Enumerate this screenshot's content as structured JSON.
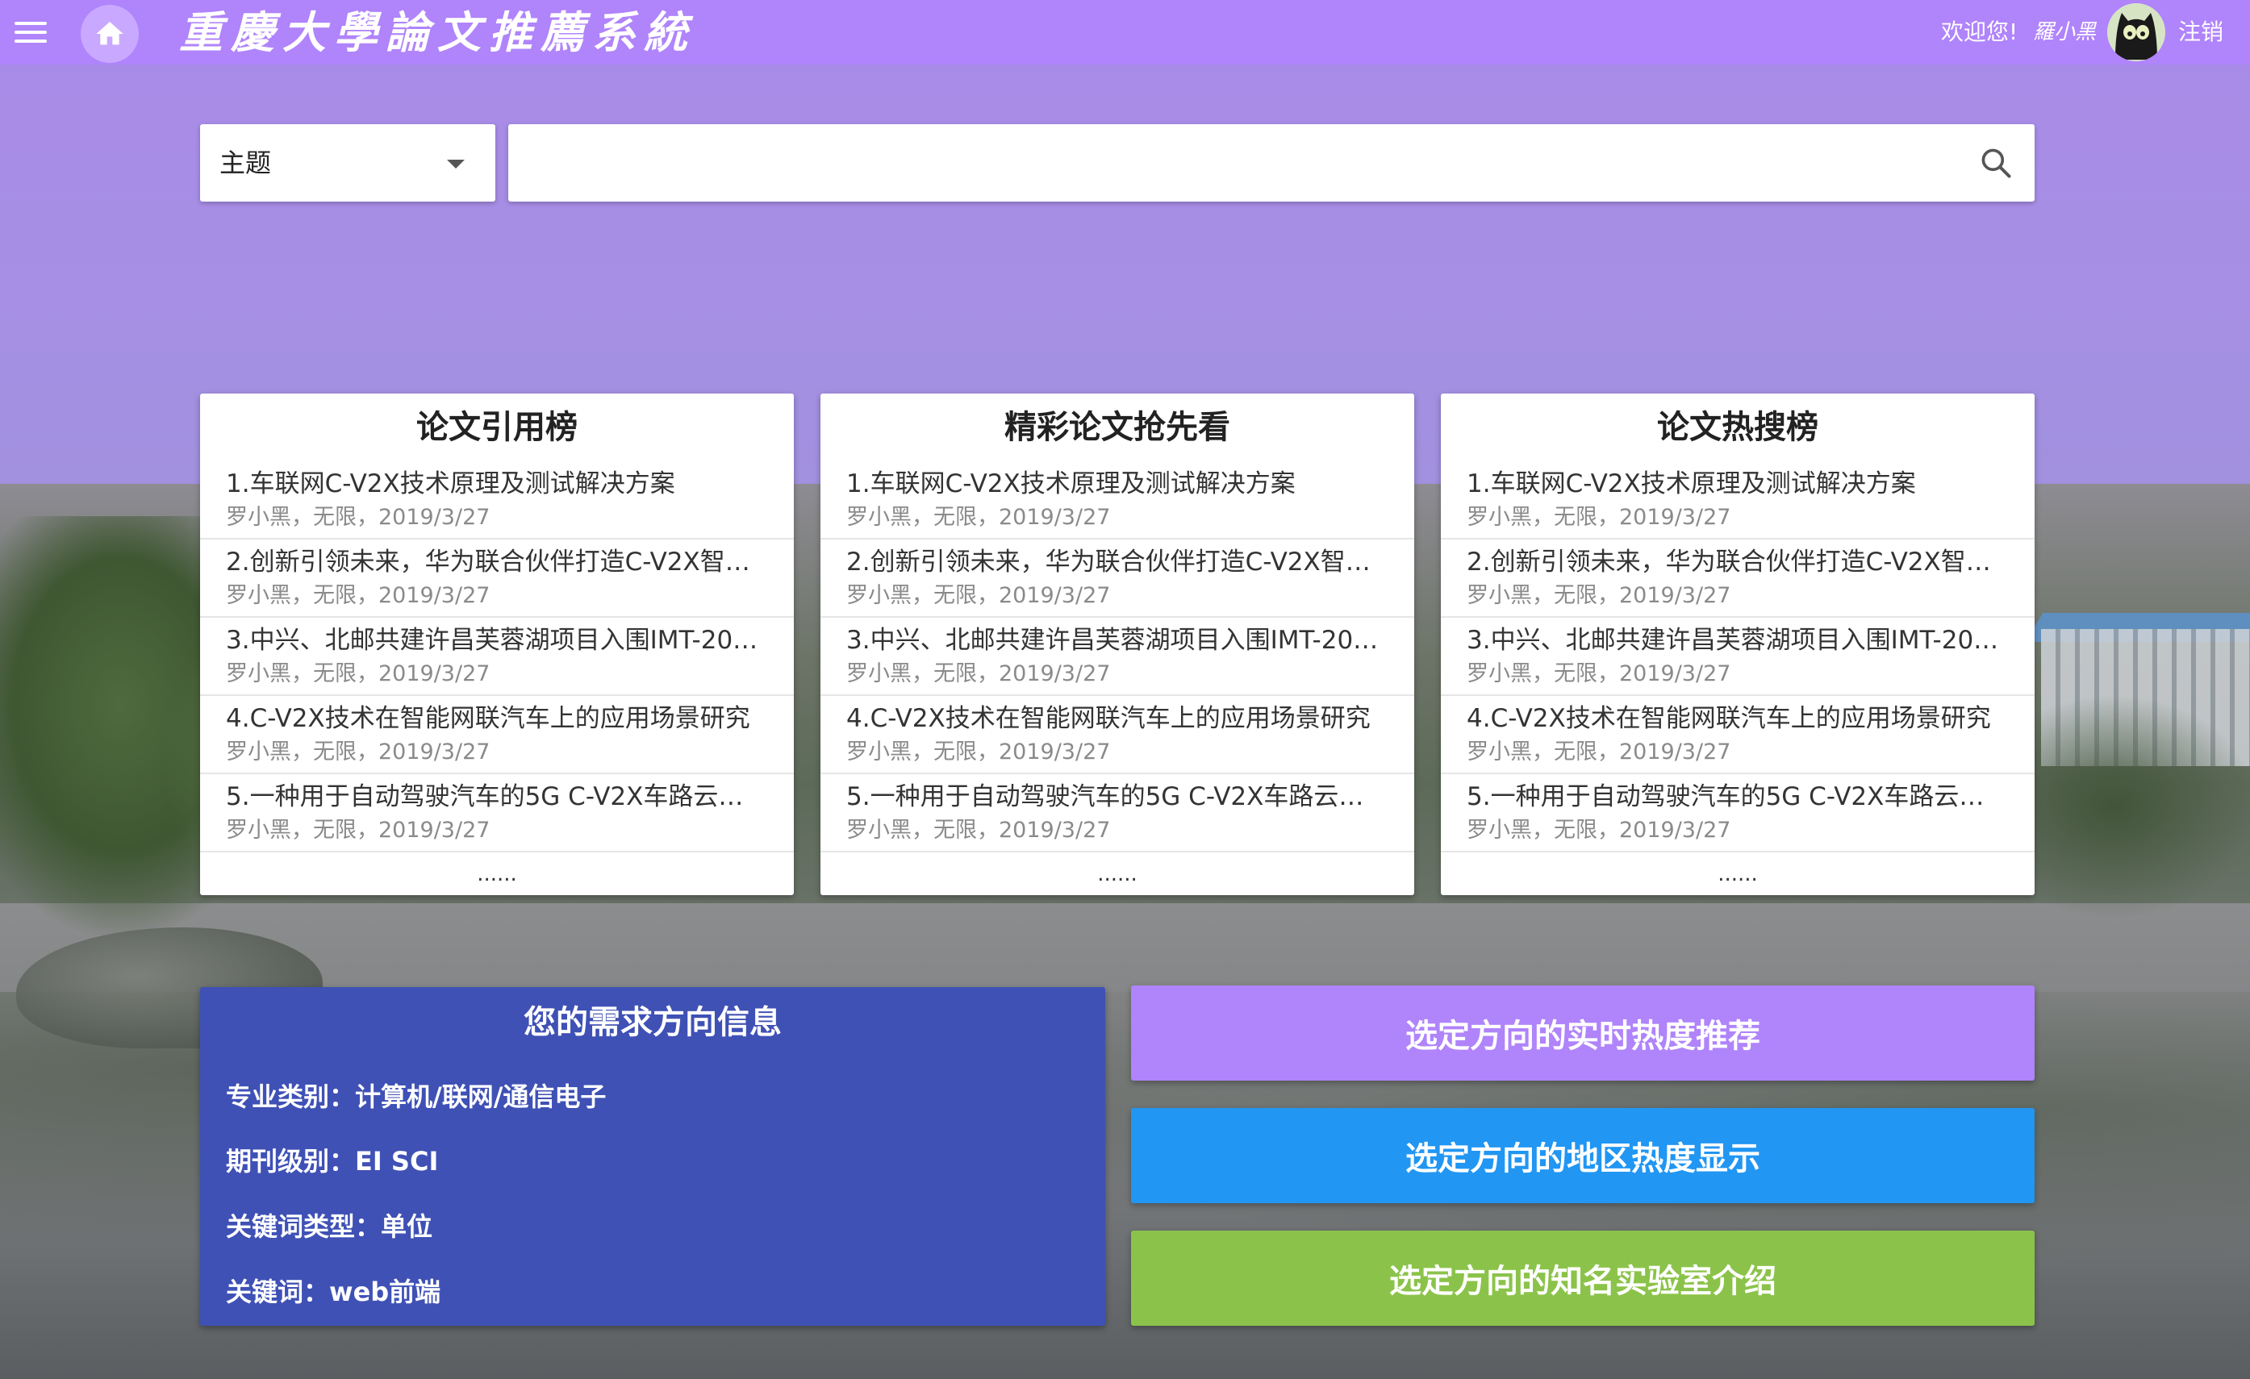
{
  "header": {
    "title": "重慶大學論文推薦系統",
    "welcome": "欢迎您!",
    "username": "羅小黑",
    "logout": "注销",
    "bar_color": "#b084fb"
  },
  "search": {
    "select_value": "主题",
    "query": "",
    "placeholder": ""
  },
  "rankings": [
    {
      "title": "论文引用榜",
      "items": [
        {
          "title": "1.车联网C-V2X技术原理及测试解决方案",
          "meta": "罗小黑，无限，2019/3/27"
        },
        {
          "title": "2.创新引领未来，华为联合伙伴打造C-V2X智…",
          "meta": "罗小黑，无限，2019/3/27"
        },
        {
          "title": "3.中兴、北邮共建许昌芙蓉湖项目入围IMT-20…",
          "meta": "罗小黑，无限，2019/3/27"
        },
        {
          "title": "4.C-V2X技术在智能网联汽车上的应用场景研究",
          "meta": "罗小黑，无限，2019/3/27"
        },
        {
          "title": "5.一种用于自动驾驶汽车的5G C-V2X车路云…",
          "meta": "罗小黑，无限，2019/3/27"
        }
      ],
      "more": "......"
    },
    {
      "title": "精彩论文抢先看",
      "items": [
        {
          "title": "1.车联网C-V2X技术原理及测试解决方案",
          "meta": "罗小黑，无限，2019/3/27"
        },
        {
          "title": "2.创新引领未来，华为联合伙伴打造C-V2X智…",
          "meta": "罗小黑，无限，2019/3/27"
        },
        {
          "title": "3.中兴、北邮共建许昌芙蓉湖项目入围IMT-20…",
          "meta": "罗小黑，无限，2019/3/27"
        },
        {
          "title": "4.C-V2X技术在智能网联汽车上的应用场景研究",
          "meta": "罗小黑，无限，2019/3/27"
        },
        {
          "title": "5.一种用于自动驾驶汽车的5G C-V2X车路云…",
          "meta": "罗小黑，无限，2019/3/27"
        }
      ],
      "more": "......"
    },
    {
      "title": "论文热搜榜",
      "items": [
        {
          "title": "1.车联网C-V2X技术原理及测试解决方案",
          "meta": "罗小黑，无限，2019/3/27"
        },
        {
          "title": "2.创新引领未来，华为联合伙伴打造C-V2X智…",
          "meta": "罗小黑，无限，2019/3/27"
        },
        {
          "title": "3.中兴、北邮共建许昌芙蓉湖项目入围IMT-20…",
          "meta": "罗小黑，无限，2019/3/27"
        },
        {
          "title": "4.C-V2X技术在智能网联汽车上的应用场景研究",
          "meta": "罗小黑，无限，2019/3/27"
        },
        {
          "title": "5.一种用于自动驾驶汽车的5G C-V2X车路云…",
          "meta": "罗小黑，无限，2019/3/27"
        }
      ],
      "more": "......"
    }
  ],
  "info": {
    "title": "您的需求方向信息",
    "major": "专业类别：计算机/联网/通信电子",
    "journal": "期刊级别：EI SCI",
    "keyword_type": "关键词类型：单位",
    "keyword": "关键词：web前端",
    "color": "#3f51b5"
  },
  "actions": [
    {
      "label": "选定方向的实时热度推荐",
      "color": "#b084fb"
    },
    {
      "label": "选定方向的地区热度显示",
      "color": "#2196f3"
    },
    {
      "label": "选定方向的知名实验室介绍",
      "color": "#8bc34a"
    }
  ],
  "icons": {
    "menu": "menu-icon",
    "home": "home-icon",
    "search": "search-icon",
    "dropdown": "chevron-down-icon",
    "avatar": "avatar-cat"
  }
}
